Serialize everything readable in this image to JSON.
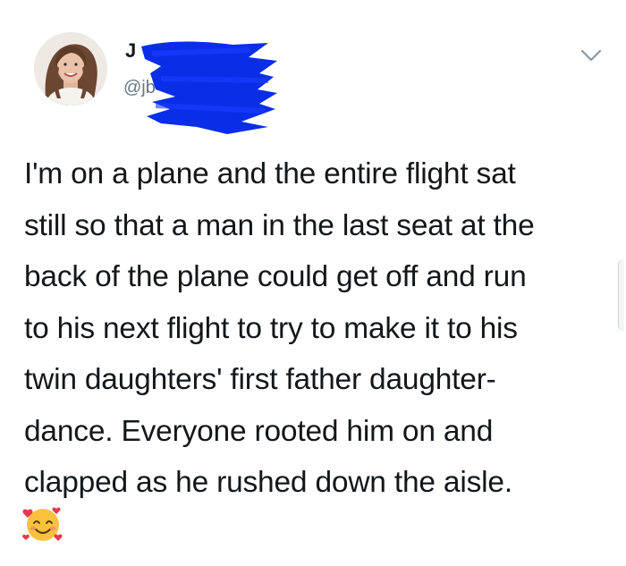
{
  "tweet": {
    "display_name_visible": "J",
    "handle_visible": "@jb",
    "text_lines": [
      "I'm on a plane and the entire flight sat",
      "still so that a man in the last seat at the",
      "back of the plane could get off and run",
      "to his next flight to try to make it to his",
      "twin daughters' first father daughter-",
      "dance. Everyone rooted him on and",
      "clapped as he rushed down the aisle."
    ],
    "emoji_icon": "smiling-face-with-hearts-icon",
    "more_icon": "chevron-down-icon",
    "redaction_color": "#0a2ee8"
  }
}
